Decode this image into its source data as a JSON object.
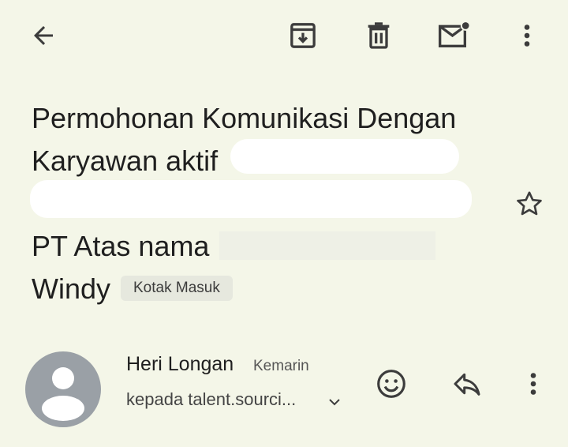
{
  "toolbar": {
    "back_icon": "arrow-back-icon",
    "archive_icon": "archive-icon",
    "delete_icon": "trash-icon",
    "mark_unread_icon": "mark-unread-icon",
    "more_icon": "more-vert-icon"
  },
  "subject": {
    "line1": "Permohonan Komunikasi Dengan",
    "line2": "Karyawan aktif",
    "line4": "PT Atas nama",
    "line5": "Windy",
    "label_chip": "Kotak Masuk",
    "star_icon": "star-outline-icon"
  },
  "sender": {
    "name": "Heri Longan",
    "time": "Kemarin",
    "recipient": "kepada talent.sourci...",
    "avatar_icon": "person-avatar-icon",
    "emoji_icon": "emoji-reaction-icon",
    "reply_icon": "reply-icon",
    "more_icon": "more-vert-icon",
    "expand_icon": "chevron-down-icon"
  },
  "colors": {
    "background": "#f4f6e8",
    "text": "#1f1f1f",
    "avatar": "#9aa0a6",
    "chip": "#e6e8de",
    "redaction": "#ffffff"
  }
}
